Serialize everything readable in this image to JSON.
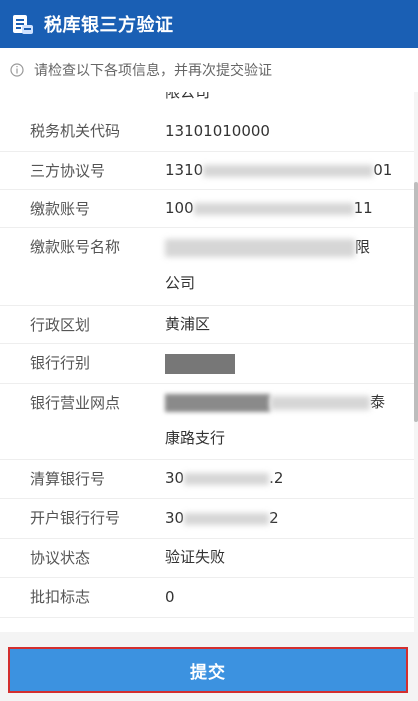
{
  "header": {
    "title": "税库银三方验证"
  },
  "notice": {
    "text": "请检查以下各项信息，并再次提交验证"
  },
  "form": {
    "cutoff_text": "限公司",
    "rows": [
      {
        "label": "税务机关代码",
        "value": "13101010000"
      },
      {
        "label": "三方协议号",
        "value_prefix": "1310",
        "value_suffix": "01"
      },
      {
        "label": "缴款账号",
        "value_prefix": "100",
        "value_suffix": "11"
      },
      {
        "label": "缴款账号名称",
        "value_line1_suffix": "限",
        "value_line2": "公司"
      },
      {
        "label": "行政区划",
        "value": "黄浦区"
      },
      {
        "label": "银行行别"
      },
      {
        "label": "银行营业网点",
        "value_line1_suffix": "泰",
        "value_line2": "康路支行"
      },
      {
        "label": "清算银行号",
        "value_prefix": "30",
        "value_suffix": ".2"
      },
      {
        "label": "开户银行行号",
        "value_prefix": "30",
        "value_suffix": "2"
      },
      {
        "label": "协议状态",
        "value": "验证失败"
      },
      {
        "label": "批扣标志",
        "value": "0"
      }
    ]
  },
  "footer": {
    "submit_label": "提交"
  },
  "colors": {
    "header_bg": "#1a5fb4",
    "submit_bg": "#3c92e0",
    "highlight_border": "#d32f2f"
  }
}
